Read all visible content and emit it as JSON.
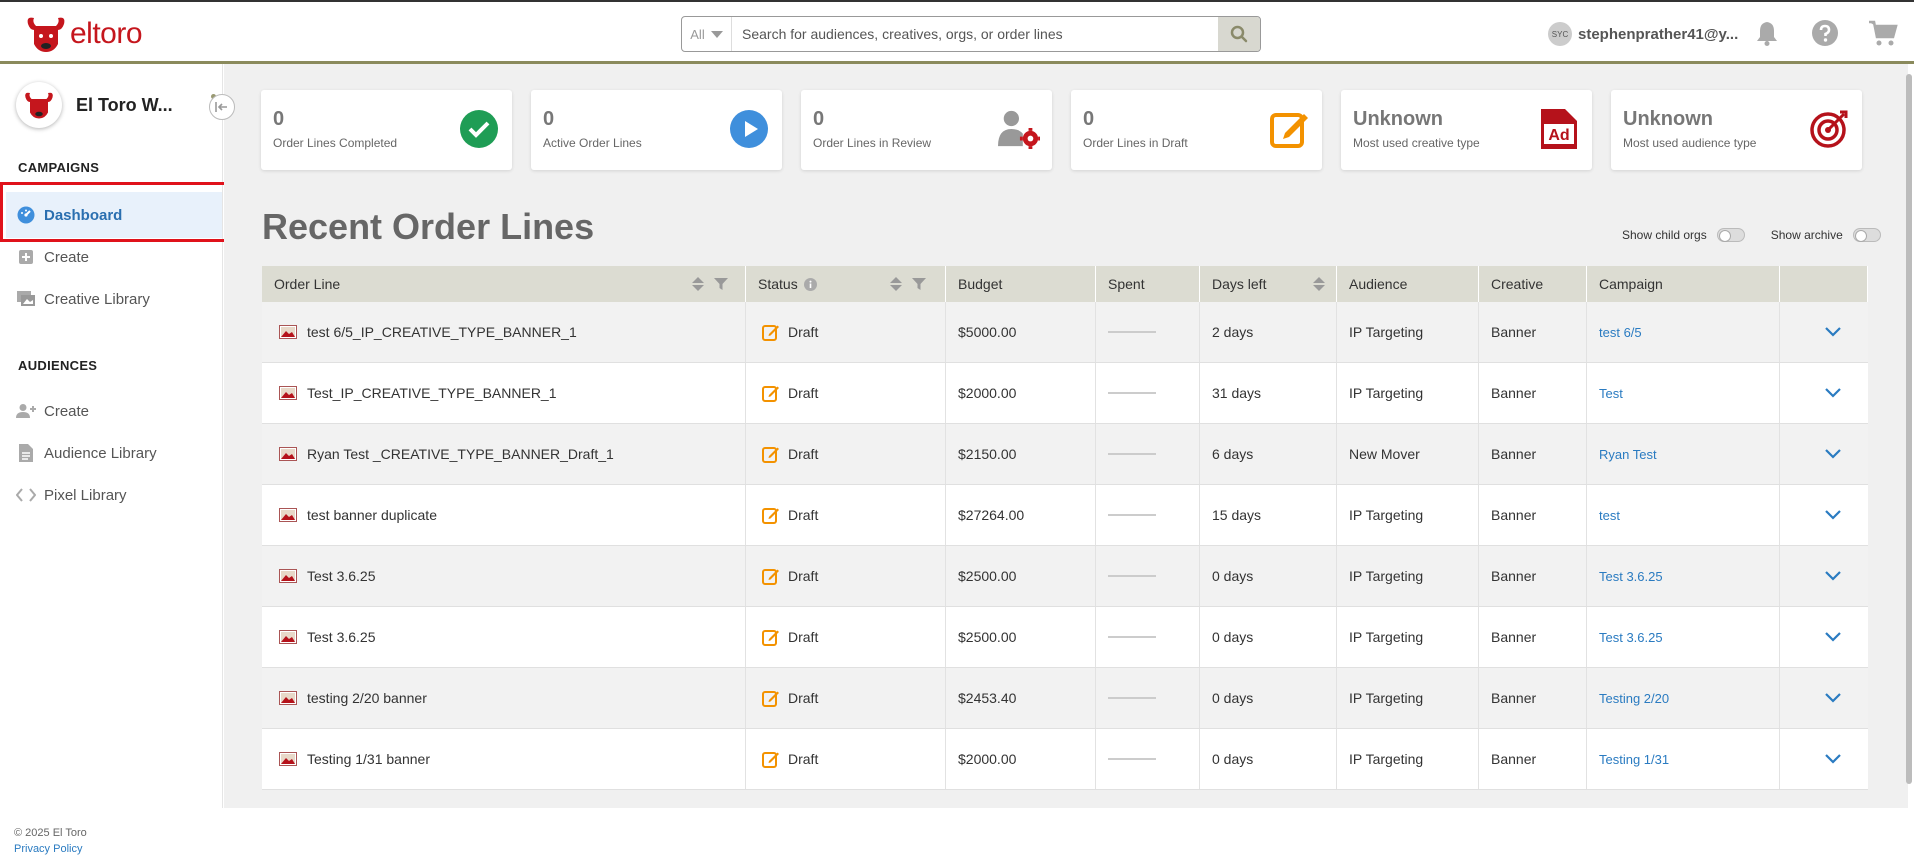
{
  "header": {
    "brand": "eltoro",
    "search_scope": "All",
    "search_placeholder": "Search for audiences, creatives, orgs, or order lines",
    "user_initials": "SYC",
    "user_email": "stephenprather41@y..."
  },
  "sidebar": {
    "org_name": "El Toro W...",
    "campaigns_title": "CAMPAIGNS",
    "campaign_items": [
      {
        "label": "Dashboard",
        "icon": "dashboard-icon"
      },
      {
        "label": "Create",
        "icon": "plus-square-icon"
      },
      {
        "label": "Creative Library",
        "icon": "images-icon"
      }
    ],
    "audiences_title": "AUDIENCES",
    "audience_items": [
      {
        "label": "Create",
        "icon": "user-plus-icon"
      },
      {
        "label": "Audience Library",
        "icon": "file-icon"
      },
      {
        "label": "Pixel Library",
        "icon": "code-icon"
      }
    ],
    "copyright": "© 2025 El Toro",
    "privacy": "Privacy Policy"
  },
  "stats": [
    {
      "value": "0",
      "label": "Order Lines Completed",
      "icon": "check-circle-icon",
      "color": "#1f9d55"
    },
    {
      "value": "0",
      "label": "Active Order Lines",
      "icon": "play-circle-icon",
      "color": "#3f8fdc"
    },
    {
      "value": "0",
      "label": "Order Lines in Review",
      "icon": "user-gear-icon",
      "color": "#c5161d"
    },
    {
      "value": "0",
      "label": "Order Lines in Draft",
      "icon": "edit-icon",
      "color": "#f39200"
    },
    {
      "value": "Unknown",
      "label": "Most used creative type",
      "icon": "ad-icon",
      "color": "#b5121b"
    },
    {
      "value": "Unknown",
      "label": "Most used audience type",
      "icon": "target-icon",
      "color": "#b5121b"
    }
  ],
  "main": {
    "title": "Recent Order Lines",
    "show_child_orgs": "Show child orgs",
    "show_archive": "Show archive"
  },
  "table": {
    "columns": [
      "Order Line",
      "Status",
      "Budget",
      "Spent",
      "Days left",
      "Audience",
      "Creative",
      "Campaign",
      ""
    ],
    "rows": [
      {
        "name": "test 6/5_IP_CREATIVE_TYPE_BANNER_1",
        "status": "Draft",
        "budget": "$5000.00",
        "days": "2 days",
        "audience": "IP Targeting",
        "creative": "Banner",
        "campaign": "test 6/5"
      },
      {
        "name": "Test_IP_CREATIVE_TYPE_BANNER_1",
        "status": "Draft",
        "budget": "$2000.00",
        "days": "31 days",
        "audience": "IP Targeting",
        "creative": "Banner",
        "campaign": "Test"
      },
      {
        "name": "Ryan Test _CREATIVE_TYPE_BANNER_Draft_1",
        "status": "Draft",
        "budget": "$2150.00",
        "days": "6 days",
        "audience": "New Mover",
        "creative": "Banner",
        "campaign": "Ryan Test"
      },
      {
        "name": "test banner duplicate",
        "status": "Draft",
        "budget": "$27264.00",
        "days": "15 days",
        "audience": "IP Targeting",
        "creative": "Banner",
        "campaign": "test"
      },
      {
        "name": "Test 3.6.25",
        "status": "Draft",
        "budget": "$2500.00",
        "days": "0 days",
        "audience": "IP Targeting",
        "creative": "Banner",
        "campaign": "Test 3.6.25"
      },
      {
        "name": "Test 3.6.25",
        "status": "Draft",
        "budget": "$2500.00",
        "days": "0 days",
        "audience": "IP Targeting",
        "creative": "Banner",
        "campaign": "Test 3.6.25"
      },
      {
        "name": "testing 2/20 banner",
        "status": "Draft",
        "budget": "$2453.40",
        "days": "0 days",
        "audience": "IP Targeting",
        "creative": "Banner",
        "campaign": "Testing 2/20"
      },
      {
        "name": "Testing 1/31 banner",
        "status": "Draft",
        "budget": "$2000.00",
        "days": "0 days",
        "audience": "IP Targeting",
        "creative": "Banner",
        "campaign": "Testing 1/31"
      }
    ]
  }
}
